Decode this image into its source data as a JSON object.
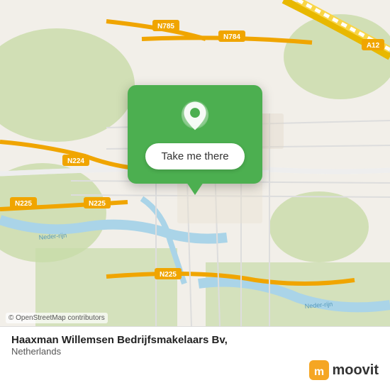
{
  "map": {
    "attribution": "© OpenStreetMap contributors",
    "popup": {
      "button_label": "Take me there"
    },
    "roads": {
      "n784": "N784",
      "n785": "N785",
      "n224": "N224",
      "n225": "N225",
      "a12": "A12"
    }
  },
  "bottom_bar": {
    "title": "Haaxman Willemsen Bedrijfsmakelaars Bv,",
    "subtitle": "Netherlands"
  },
  "moovit": {
    "label": "moovit"
  }
}
